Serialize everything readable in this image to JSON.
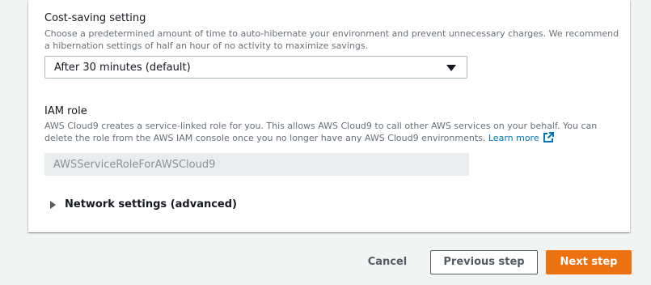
{
  "cost_saving": {
    "label": "Cost-saving setting",
    "description": "Choose a predetermined amount of time to auto-hibernate your environment and prevent unnecessary charges. We recommend a hibernation settings of half an hour of no activity to maximize savings.",
    "selected_value": "After 30 minutes (default)",
    "caret_icon": "caret-down-icon"
  },
  "iam_role": {
    "label": "IAM role",
    "description": "AWS Cloud9 creates a service-linked role for you. This allows AWS Cloud9 to call other AWS services on your behalf. You can delete the role from the AWS IAM console once you no longer have any AWS Cloud9 environments.",
    "learn_more": "Learn more",
    "learn_more_icon": "external-link-icon",
    "value": "AWSServiceRoleForAWSCloud9"
  },
  "network_settings": {
    "label": "Network settings (advanced)",
    "icon": "caret-right-icon"
  },
  "footer": {
    "cancel": "Cancel",
    "previous": "Previous step",
    "next": "Next step"
  },
  "colors": {
    "primary_button": "#ec7211",
    "link": "#0073bb",
    "page_background": "#f2f3f3"
  }
}
